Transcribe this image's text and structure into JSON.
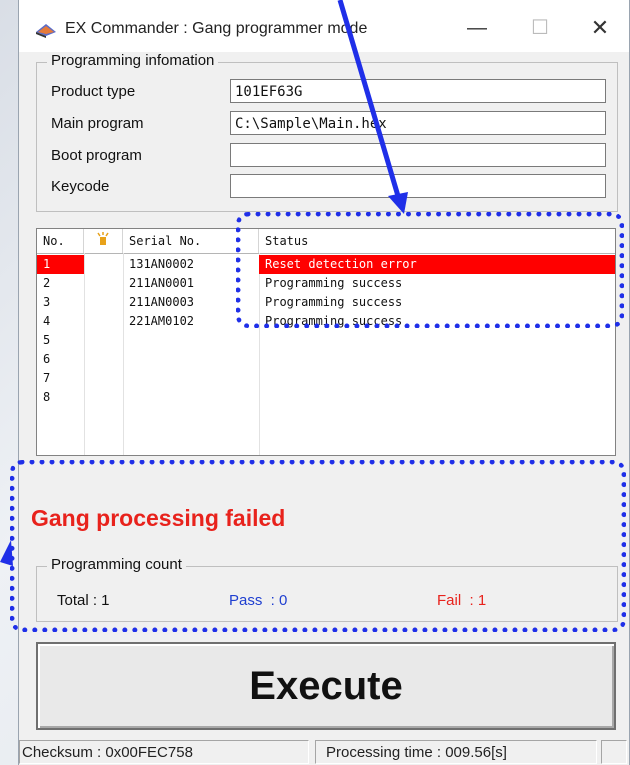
{
  "window": {
    "title": "EX Commander : Gang programmer mode"
  },
  "programming_info": {
    "legend": "Programming infomation",
    "product_type": {
      "label": "Product type",
      "value": "101EF63G"
    },
    "main_program": {
      "label": "Main program",
      "value": "C:\\Sample\\Main.hex"
    },
    "boot_program": {
      "label": "Boot program",
      "value": ""
    },
    "keycode": {
      "label": "Keycode",
      "value": ""
    }
  },
  "device_list": {
    "columns": {
      "no": "No.",
      "serial": "Serial No.",
      "status": "Status"
    },
    "rows": [
      {
        "no": "1",
        "serial": "131AN0002",
        "status": "Reset detection error",
        "selected": true
      },
      {
        "no": "2",
        "serial": "211AN0001",
        "status": "Programming success"
      },
      {
        "no": "3",
        "serial": "211AN0003",
        "status": "Programming success"
      },
      {
        "no": "4",
        "serial": "221AM0102",
        "status": "Programming success"
      },
      {
        "no": "5",
        "serial": "",
        "status": ""
      },
      {
        "no": "6",
        "serial": "",
        "status": ""
      },
      {
        "no": "7",
        "serial": "",
        "status": ""
      },
      {
        "no": "8",
        "serial": "",
        "status": ""
      }
    ],
    "selected_color": "#ff0000"
  },
  "result_message": "Gang processing failed",
  "programming_count": {
    "legend": "Programming count",
    "total": "Total : 1",
    "pass": "Pass  : 0",
    "fail": "Fail  : 1",
    "pass_color": "#1f3fd0",
    "fail_color": "#e8221c"
  },
  "execute_button": {
    "label": "Execute"
  },
  "status_bar": {
    "checksum": "Checksum : 0x00FEC758",
    "processing_time": "Processing time : 009.56[s]"
  },
  "annotation_color": "#1f2fe8"
}
